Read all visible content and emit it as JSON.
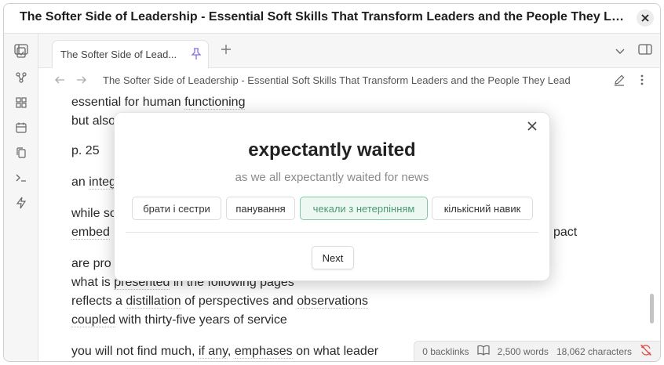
{
  "window": {
    "title": "The Softer Side of Leadership - Essential Soft Skills That Transform Leaders and the People They Lead - ..."
  },
  "tab": {
    "label": "The Softer Side of Lead..."
  },
  "navbar": {
    "title": "The Softer Side of Leadership - Essential Soft Skills That Transform Leaders and the People They Lead"
  },
  "content": {
    "l1_a": "essential for human ",
    "l1_b": "functioning",
    "l2": "but also",
    "l3": "p. 25",
    "l4_a": "an ",
    "l4_b": "integ",
    "l5": "while so",
    "l6_a": "embed",
    "l6_b": "pact",
    "l7": "are pro",
    "l8_a": "what is ",
    "l8_b": "presented",
    "l8_c": " in the following pages",
    "l9_a": "reflects a ",
    "l9_b": "distillation",
    "l9_c": " of perspectives and ",
    "l9_d": "observations",
    "l10_a": "coupled",
    "l10_b": " with thirty-five years of service",
    "l11_a": "you will not find much, ",
    "l11_b": "if any",
    "l11_c": ", ",
    "l11_d": "emphases",
    "l11_e": " on what leader"
  },
  "statusbar": {
    "backlinks": "0 backlinks",
    "words": "2,500 words",
    "characters": "18,062 characters"
  },
  "quiz": {
    "word": "expectantly waited",
    "context": "as we all expectantly waited for news",
    "options": [
      "брати і сестри",
      "панування",
      "чекали з нетерпінням",
      "кількісний навик"
    ],
    "selected_index": 2,
    "next_label": "Next"
  },
  "colors": {
    "accent": "#7fcaa6",
    "selected_text": "#4a9a73",
    "pin": "#8a6ee0",
    "sync_error": "#e24a4a"
  }
}
